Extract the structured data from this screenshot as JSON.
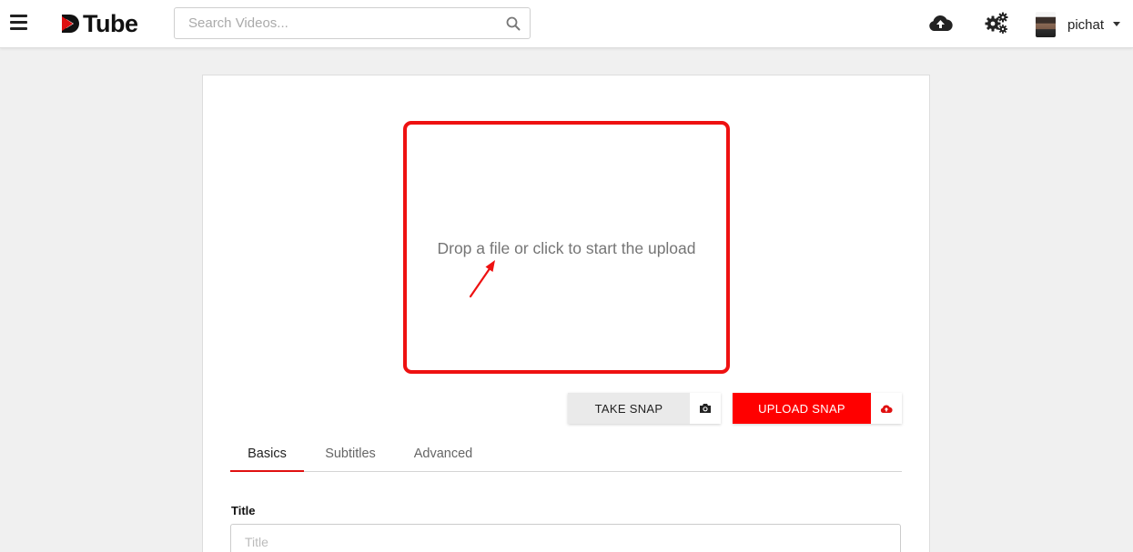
{
  "header": {
    "logo_text": "Tube",
    "search": {
      "placeholder": "Search Videos...",
      "value": ""
    },
    "user": {
      "name": "pichat"
    }
  },
  "upload": {
    "dropzone_text": "Drop a file or click to start the upload",
    "take_snap_label": "TAKE SNAP",
    "upload_snap_label": "UPLOAD SNAP"
  },
  "tabs": [
    {
      "label": "Basics",
      "active": true
    },
    {
      "label": "Subtitles",
      "active": false
    },
    {
      "label": "Advanced",
      "active": false
    }
  ],
  "form": {
    "title_label": "Title",
    "title_placeholder": "Title",
    "title_value": ""
  },
  "colors": {
    "brand_red": "#ff0000",
    "highlight_border": "#ee1111",
    "background": "#f0f0f0"
  },
  "icons": {
    "menu": "hamburger-menu-icon",
    "search": "search-icon",
    "upload": "cloud-upload-icon",
    "settings": "gears-icon",
    "camera": "camera-icon",
    "upload_snap": "cloud-upload-icon"
  }
}
